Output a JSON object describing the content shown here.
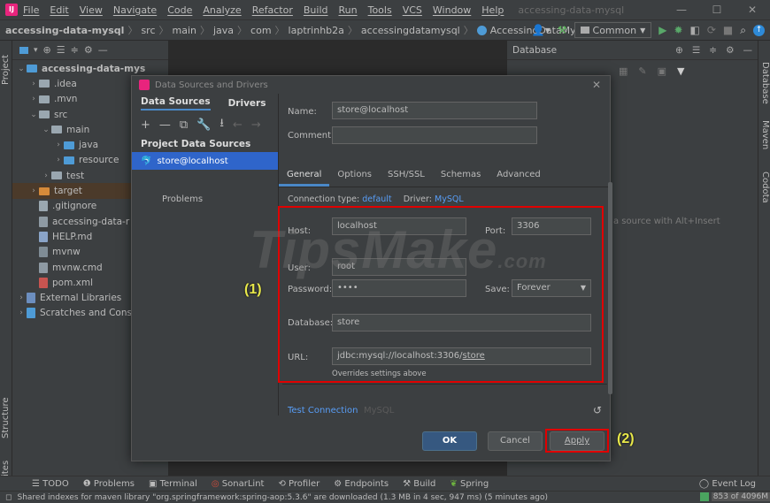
{
  "menubar": {
    "items": [
      "File",
      "Edit",
      "View",
      "Navigate",
      "Code",
      "Analyze",
      "Refactor",
      "Build",
      "Run",
      "Tools",
      "VCS",
      "Window",
      "Help"
    ],
    "project_name": "accessing-data-mysql"
  },
  "navbar": {
    "breadcrumbs": [
      "accessing-data-mysql",
      "src",
      "main",
      "java",
      "com",
      "laptrinhb2a",
      "accessingdatamysql",
      "AccessingDataMysqlApp"
    ],
    "run_config": "Common"
  },
  "left_stripe": {
    "tabs": [
      "Project",
      "Structure",
      "Favorites"
    ]
  },
  "right_stripe": {
    "tabs": [
      "Database",
      "Maven",
      "Codota"
    ]
  },
  "project_tree": [
    {
      "label": "accessing-data-mys",
      "indent": 0,
      "arrow": "v",
      "icon": "module-folder-icon",
      "bold": true
    },
    {
      "label": ".idea",
      "indent": 1,
      "arrow": ">",
      "icon": "folder-icon"
    },
    {
      "label": ".mvn",
      "indent": 1,
      "arrow": ">",
      "icon": "folder-icon"
    },
    {
      "label": "src",
      "indent": 1,
      "arrow": "v",
      "icon": "folder-icon"
    },
    {
      "label": "main",
      "indent": 2,
      "arrow": "v",
      "icon": "folder-icon"
    },
    {
      "label": "java",
      "indent": 3,
      "arrow": ">",
      "icon": "source-folder-icon"
    },
    {
      "label": "resource",
      "indent": 3,
      "arrow": ">",
      "icon": "resource-folder-icon"
    },
    {
      "label": "test",
      "indent": 2,
      "arrow": ">",
      "icon": "folder-icon"
    },
    {
      "label": "target",
      "indent": 1,
      "arrow": ">",
      "icon": "excluded-folder-icon",
      "highlight": true
    },
    {
      "label": ".gitignore",
      "indent": 1,
      "arrow": "",
      "icon": "gitignore-file-icon"
    },
    {
      "label": "accessing-data-r",
      "indent": 1,
      "arrow": "",
      "icon": "file-icon"
    },
    {
      "label": "HELP.md",
      "indent": 1,
      "arrow": "",
      "icon": "markdown-file-icon"
    },
    {
      "label": "mvnw",
      "indent": 1,
      "arrow": "",
      "icon": "script-file-icon"
    },
    {
      "label": "mvnw.cmd",
      "indent": 1,
      "arrow": "",
      "icon": "file-icon"
    },
    {
      "label": "pom.xml",
      "indent": 1,
      "arrow": "",
      "icon": "maven-file-icon"
    },
    {
      "label": "External Libraries",
      "indent": 0,
      "arrow": ">",
      "icon": "library-icon"
    },
    {
      "label": "Scratches and Consc",
      "indent": 0,
      "arrow": ">",
      "icon": "scratches-icon"
    }
  ],
  "db_panel": {
    "title": "Database",
    "hint": "a source with Alt+Insert"
  },
  "dialog": {
    "title": "Data Sources and Drivers",
    "left_tabs": [
      "Data Sources",
      "Drivers"
    ],
    "section": "Project Data Sources",
    "selected_item": "store@localhost",
    "problems": "Problems",
    "name_label": "Name:",
    "name_value": "store@localhost",
    "comment_label": "Comment:",
    "comment_value": "",
    "tabs": [
      "General",
      "Options",
      "SSH/SSL",
      "Schemas",
      "Advanced"
    ],
    "connection_type_label": "Connection type:",
    "connection_type_value": "default",
    "driver_label": "Driver:",
    "driver_value": "MySQL",
    "host_label": "Host:",
    "host_value": "localhost",
    "port_label": "Port:",
    "port_value": "3306",
    "user_label": "User:",
    "user_value": "root",
    "password_label": "Password:",
    "password_value": "••••",
    "save_label": "Save:",
    "save_value": "Forever",
    "database_label": "Database:",
    "database_value": "store",
    "url_label": "URL:",
    "url_value_prefix": "jdbc:mysql://localhost:3306/",
    "url_value_db": "store",
    "url_note": "Overrides settings above",
    "test_connection": "Test Connection",
    "test_driver": "MySQL",
    "ok": "OK",
    "cancel": "Cancel",
    "apply": "Apply"
  },
  "annotations": {
    "label1": "(1)",
    "label2": "(2)"
  },
  "watermark": {
    "main": "TipsMake",
    "suffix": ".com"
  },
  "bottom_tools": [
    "TODO",
    "Problems",
    "Terminal",
    "SonarLint",
    "Profiler",
    "Endpoints",
    "Build",
    "Spring"
  ],
  "event_log": "Event Log",
  "status": {
    "message": "Shared indexes for maven library \"org.springframework:spring-aop:5.3.6\" are downloaded (1.3 MB in 4 sec, 947 ms) (5 minutes ago)",
    "memory": "853 of 4096M"
  },
  "colors": {
    "accent": "#2f65ca",
    "annotation_red": "#e00000",
    "annotation_text": "#e8e84a"
  }
}
